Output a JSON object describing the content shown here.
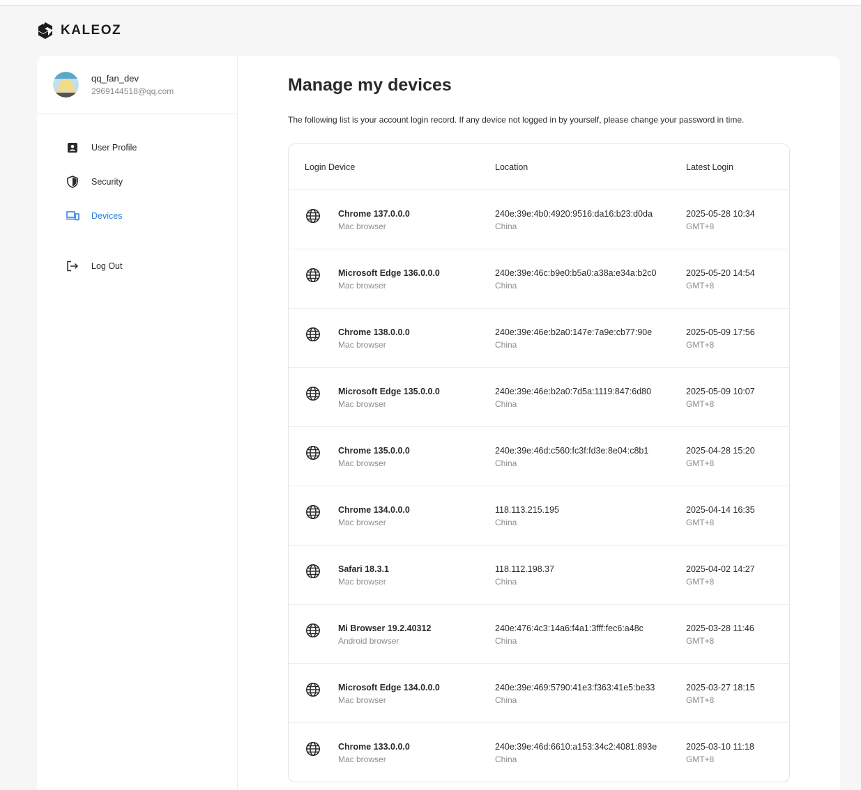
{
  "brand": {
    "name": "KALEOZ"
  },
  "user": {
    "name": "qq_fan_dev",
    "email": "2969144518@qq.com"
  },
  "nav": {
    "items": [
      {
        "label": "User Profile",
        "icon": "user-profile-icon"
      },
      {
        "label": "Security",
        "icon": "shield-icon"
      },
      {
        "label": "Devices",
        "icon": "devices-icon",
        "active": true
      },
      {
        "label": "Log Out",
        "icon": "logout-icon"
      }
    ]
  },
  "page": {
    "title": "Manage my devices",
    "description": "The following list is your account login record. If any device not logged in by yourself, please change your password in time."
  },
  "table": {
    "headers": [
      "Login Device",
      "Location",
      "Latest Login"
    ],
    "rows": [
      {
        "device": "Chrome 137.0.0.0",
        "platform": "Mac browser",
        "ip": "240e:39e:4b0:4920:9516:da16:b23:d0da",
        "country": "China",
        "date": "2025-05-28 10:34",
        "tz": "GMT+8"
      },
      {
        "device": "Microsoft Edge 136.0.0.0",
        "platform": "Mac browser",
        "ip": "240e:39e:46c:b9e0:b5a0:a38a:e34a:b2c0",
        "country": "China",
        "date": "2025-05-20 14:54",
        "tz": "GMT+8"
      },
      {
        "device": "Chrome 138.0.0.0",
        "platform": "Mac browser",
        "ip": "240e:39e:46e:b2a0:147e:7a9e:cb77:90e",
        "country": "China",
        "date": "2025-05-09 17:56",
        "tz": "GMT+8"
      },
      {
        "device": "Microsoft Edge 135.0.0.0",
        "platform": "Mac browser",
        "ip": "240e:39e:46e:b2a0:7d5a:1119:847:6d80",
        "country": "China",
        "date": "2025-05-09 10:07",
        "tz": "GMT+8"
      },
      {
        "device": "Chrome 135.0.0.0",
        "platform": "Mac browser",
        "ip": "240e:39e:46d:c560:fc3f:fd3e:8e04:c8b1",
        "country": "China",
        "date": "2025-04-28 15:20",
        "tz": "GMT+8"
      },
      {
        "device": "Chrome 134.0.0.0",
        "platform": "Mac browser",
        "ip": "118.113.215.195",
        "country": "China",
        "date": "2025-04-14 16:35",
        "tz": "GMT+8"
      },
      {
        "device": "Safari 18.3.1",
        "platform": "Mac browser",
        "ip": "118.112.198.37",
        "country": "China",
        "date": "2025-04-02 14:27",
        "tz": "GMT+8"
      },
      {
        "device": "Mi Browser 19.2.40312",
        "platform": "Android browser",
        "ip": "240e:476:4c3:14a6:f4a1:3fff:fec6:a48c",
        "country": "China",
        "date": "2025-03-28 11:46",
        "tz": "GMT+8"
      },
      {
        "device": "Microsoft Edge 134.0.0.0",
        "platform": "Mac browser",
        "ip": "240e:39e:469:5790:41e3:f363:41e5:be33",
        "country": "China",
        "date": "2025-03-27 18:15",
        "tz": "GMT+8"
      },
      {
        "device": "Chrome 133.0.0.0",
        "platform": "Mac browser",
        "ip": "240e:39e:46d:6610:a153:34c2:4081:893e",
        "country": "China",
        "date": "2025-03-10 11:18",
        "tz": "GMT+8"
      }
    ]
  },
  "colors": {
    "accent": "#2a7de1",
    "background": "#f6f6f6"
  }
}
